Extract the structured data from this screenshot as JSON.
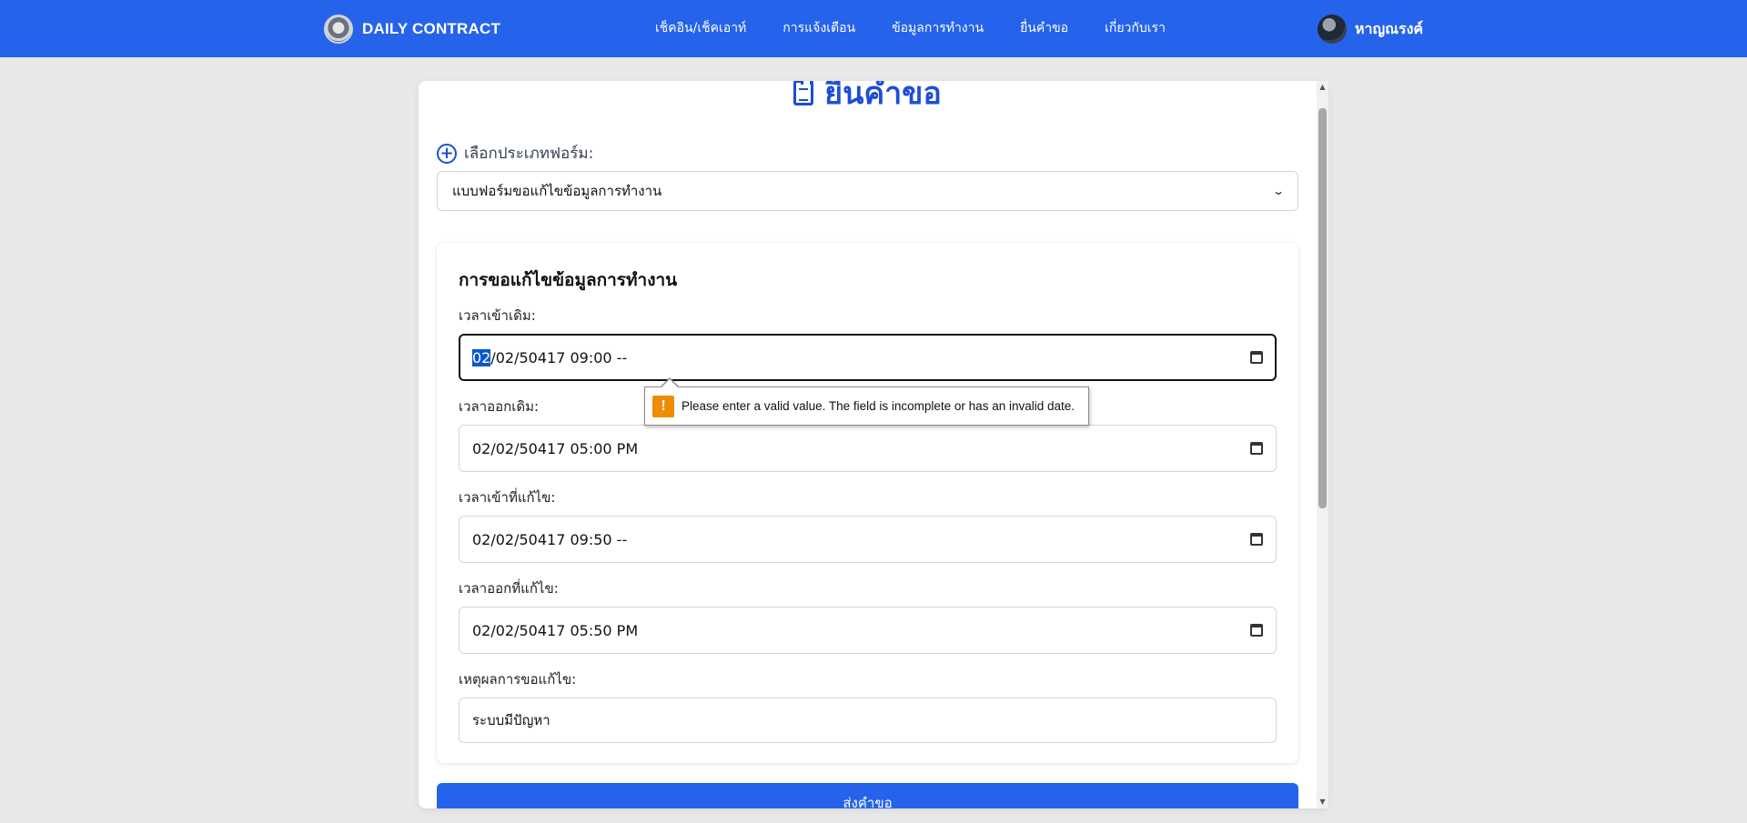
{
  "navbar": {
    "brand": "DAILY CONTRACT",
    "links": [
      "เช็คอิน/เช็คเอาท์",
      "การแจ้งเตือน",
      "ข้อมูลการทำงาน",
      "ยื่นคำขอ",
      "เกี่ยวกับเรา"
    ],
    "user_name": "หาญณรงค์"
  },
  "page": {
    "title": "ยื่นคำขอ",
    "form_type_label": "เลือกประเภทฟอร์ม:",
    "form_type_selected": "แบบฟอร์มขอแก้ไขข้อมูลการทำงาน"
  },
  "form": {
    "heading": "การขอแก้ไขข้อมูลการทำงาน",
    "original_in_label": "เวลาเข้าเดิม:",
    "original_in_value_highlight": "02",
    "original_in_value_rest": "/02/50417  09:00  --",
    "original_out_label": "เวลาออกเดิม:",
    "original_out_value": "02/02/50417  05:00  PM",
    "corrected_in_label": "เวลาเข้าที่แก้ไข:",
    "corrected_in_value": "02/02/50417  09:50  --",
    "corrected_out_label": "เวลาออกที่แก้ไข:",
    "corrected_out_value": "02/02/50417  05:50  PM",
    "reason_label": "เหตุผลการขอแก้ไข:",
    "reason_value": "ระบบมีปัญหา",
    "submit_label": "ส่งคำขอ"
  },
  "validation_tooltip": {
    "message": "Please enter a valid value. The field is incomplete or has an invalid date."
  },
  "colors": {
    "primary": "#2563eb",
    "title": "#1d4ed8",
    "warning": "#f08c00"
  },
  "icons": {
    "brand": "brand-logo-icon",
    "title": "clipboard-icon",
    "form_type": "plus-circle-icon",
    "date": "calendar-icon",
    "warning": "warning-icon"
  }
}
